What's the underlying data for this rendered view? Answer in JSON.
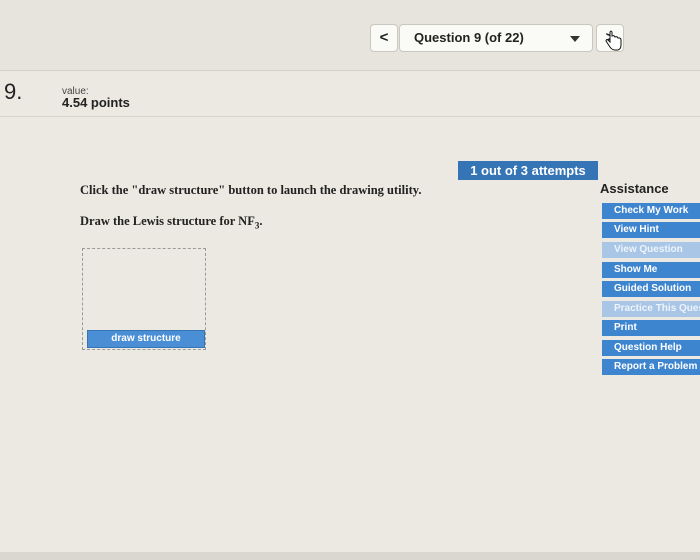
{
  "nav": {
    "prev_label": "<",
    "question_label": "Question 9 (of 22)",
    "next_label": ">"
  },
  "question": {
    "number": "9.",
    "value_label": "value:",
    "points": "4.54 points"
  },
  "content": {
    "instruction_1": "Click the \"draw structure\" button to launch the drawing utility.",
    "instruction_2_text": "Draw the Lewis structure for NF",
    "instruction_2_sub": "3",
    "instruction_2_end": ".",
    "draw_button": "draw structure"
  },
  "attempts": "1 out of 3 attempts",
  "assistance": {
    "title": "Assistance",
    "items": [
      {
        "label": "Check My Work",
        "enabled": true
      },
      {
        "label": "View Hint",
        "enabled": true
      },
      {
        "label": "View Question",
        "enabled": false
      },
      {
        "label": "Show Me",
        "enabled": true
      },
      {
        "label": "Guided Solution",
        "enabled": true
      },
      {
        "label": "Practice This Question",
        "enabled": false
      },
      {
        "label": "Print",
        "enabled": true
      },
      {
        "label": "Question Help",
        "enabled": true
      },
      {
        "label": "Report a Problem",
        "enabled": true
      }
    ]
  },
  "colors": {
    "accent": "#3e85cf",
    "disabled": "#a9c6e6",
    "background": "#ebe9e1"
  }
}
